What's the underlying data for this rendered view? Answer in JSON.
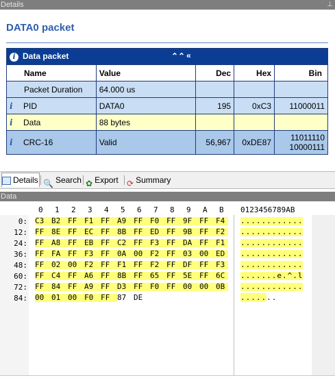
{
  "panel_title": "Details",
  "heading": "DATA0 packet",
  "table": {
    "title": "Data packet",
    "collapse_icons": "⮝ «",
    "columns": [
      "Name",
      "Value",
      "Dec",
      "Hex",
      "Bin"
    ],
    "rows": [
      {
        "name": "Packet Duration",
        "value": "64.000 us",
        "dec": "",
        "hex": "",
        "bin": ""
      },
      {
        "name": "PID",
        "value": "DATA0",
        "dec": "195",
        "hex": "0xC3",
        "bin": "11000011"
      },
      {
        "name": "Data",
        "value": "88 bytes",
        "dec": "",
        "hex": "",
        "bin": ""
      },
      {
        "name": "CRC-16",
        "value": "Valid",
        "dec": "56,967",
        "hex": "0xDE87",
        "bin1": "11011110",
        "bin2": "10000111"
      }
    ]
  },
  "tabs": [
    "Details",
    "Search",
    "Export",
    "Summary"
  ],
  "data_panel_title": "Data",
  "hex": {
    "col_headers": [
      "0",
      "1",
      "2",
      "3",
      "4",
      "5",
      "6",
      "7",
      "8",
      "9",
      "A",
      "B"
    ],
    "ascii_header": "0123456789AB",
    "rows": [
      {
        "offset": "0:",
        "bytes": [
          "C3",
          "B2",
          "FF",
          "F1",
          "FF",
          "A9",
          "FF",
          "F0",
          "FF",
          "9F",
          "FF",
          "F4"
        ],
        "ascii": "............"
      },
      {
        "offset": "12:",
        "bytes": [
          "FF",
          "8E",
          "FF",
          "EC",
          "FF",
          "8B",
          "FF",
          "ED",
          "FF",
          "9B",
          "FF",
          "F2"
        ],
        "ascii": "............"
      },
      {
        "offset": "24:",
        "bytes": [
          "FF",
          "A8",
          "FF",
          "EB",
          "FF",
          "C2",
          "FF",
          "F3",
          "FF",
          "DA",
          "FF",
          "F1"
        ],
        "ascii": "............"
      },
      {
        "offset": "36:",
        "bytes": [
          "FF",
          "FA",
          "FF",
          "F3",
          "FF",
          "0A",
          "00",
          "F2",
          "FF",
          "03",
          "00",
          "ED"
        ],
        "ascii": "............"
      },
      {
        "offset": "48:",
        "bytes": [
          "FF",
          "02",
          "00",
          "F2",
          "FF",
          "F1",
          "FF",
          "F2",
          "FF",
          "DF",
          "FF",
          "F3"
        ],
        "ascii": "............"
      },
      {
        "offset": "60:",
        "bytes": [
          "FF",
          "C4",
          "FF",
          "A6",
          "FF",
          "8B",
          "FF",
          "65",
          "FF",
          "5E",
          "FF",
          "6C"
        ],
        "ascii": ".......e.^.l"
      },
      {
        "offset": "72:",
        "bytes": [
          "FF",
          "84",
          "FF",
          "A9",
          "FF",
          "D3",
          "FF",
          "F0",
          "FF",
          "00",
          "00",
          "0B"
        ],
        "ascii": "............"
      },
      {
        "offset": "84:",
        "bytes": [
          "00",
          "01",
          "00",
          "F0",
          "FF",
          "87",
          "DE"
        ],
        "ascii": "......."
      }
    ]
  },
  "colors": {
    "header_blue": "#0b3d94",
    "highlight_yellow": "#ffff7a",
    "heading_blue": "#2f5dad"
  }
}
